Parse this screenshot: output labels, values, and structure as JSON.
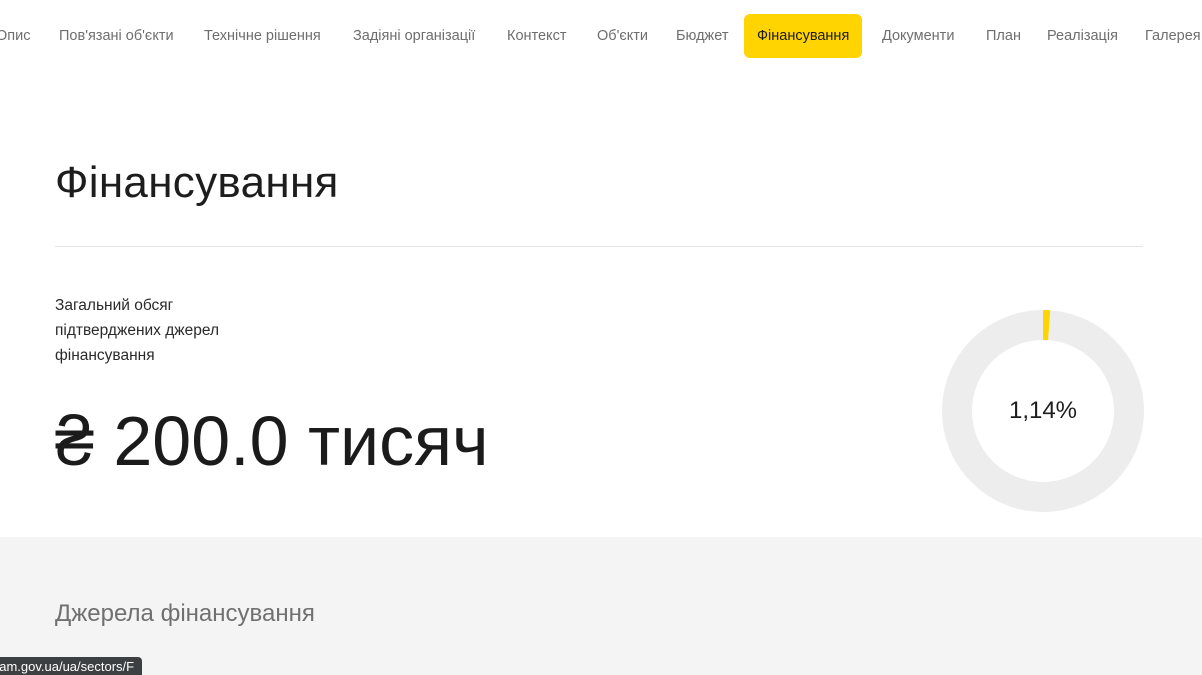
{
  "nav": {
    "tabs": [
      {
        "label": "Опис",
        "active": false
      },
      {
        "label": "Пов'язані об'єкти",
        "active": false
      },
      {
        "label": "Технічне рішення",
        "active": false
      },
      {
        "label": "Задіяні організації",
        "active": false
      },
      {
        "label": "Контекст",
        "active": false
      },
      {
        "label": "Об'єкти",
        "active": false
      },
      {
        "label": "Бюджет",
        "active": false
      },
      {
        "label": "Фінансування",
        "active": true
      },
      {
        "label": "Документи",
        "active": false
      },
      {
        "label": "План",
        "active": false
      },
      {
        "label": "Реалізація",
        "active": false
      },
      {
        "label": "Галерея",
        "active": false
      }
    ],
    "active_color": "#ffd400"
  },
  "financing": {
    "title": "Фінансування",
    "caption": "Загальний обсяг підтверджених джерел фінансування",
    "amount": "₴ 200.0 тисяч",
    "percent_label": "1,14%",
    "percent_value": 1.14,
    "ring_color": "#ffd400",
    "ring_track_color": "#ededed"
  },
  "sources": {
    "title": "Джерела фінансування"
  },
  "status_bar": {
    "url": "eam.gov.ua/ua/sectors/F"
  }
}
